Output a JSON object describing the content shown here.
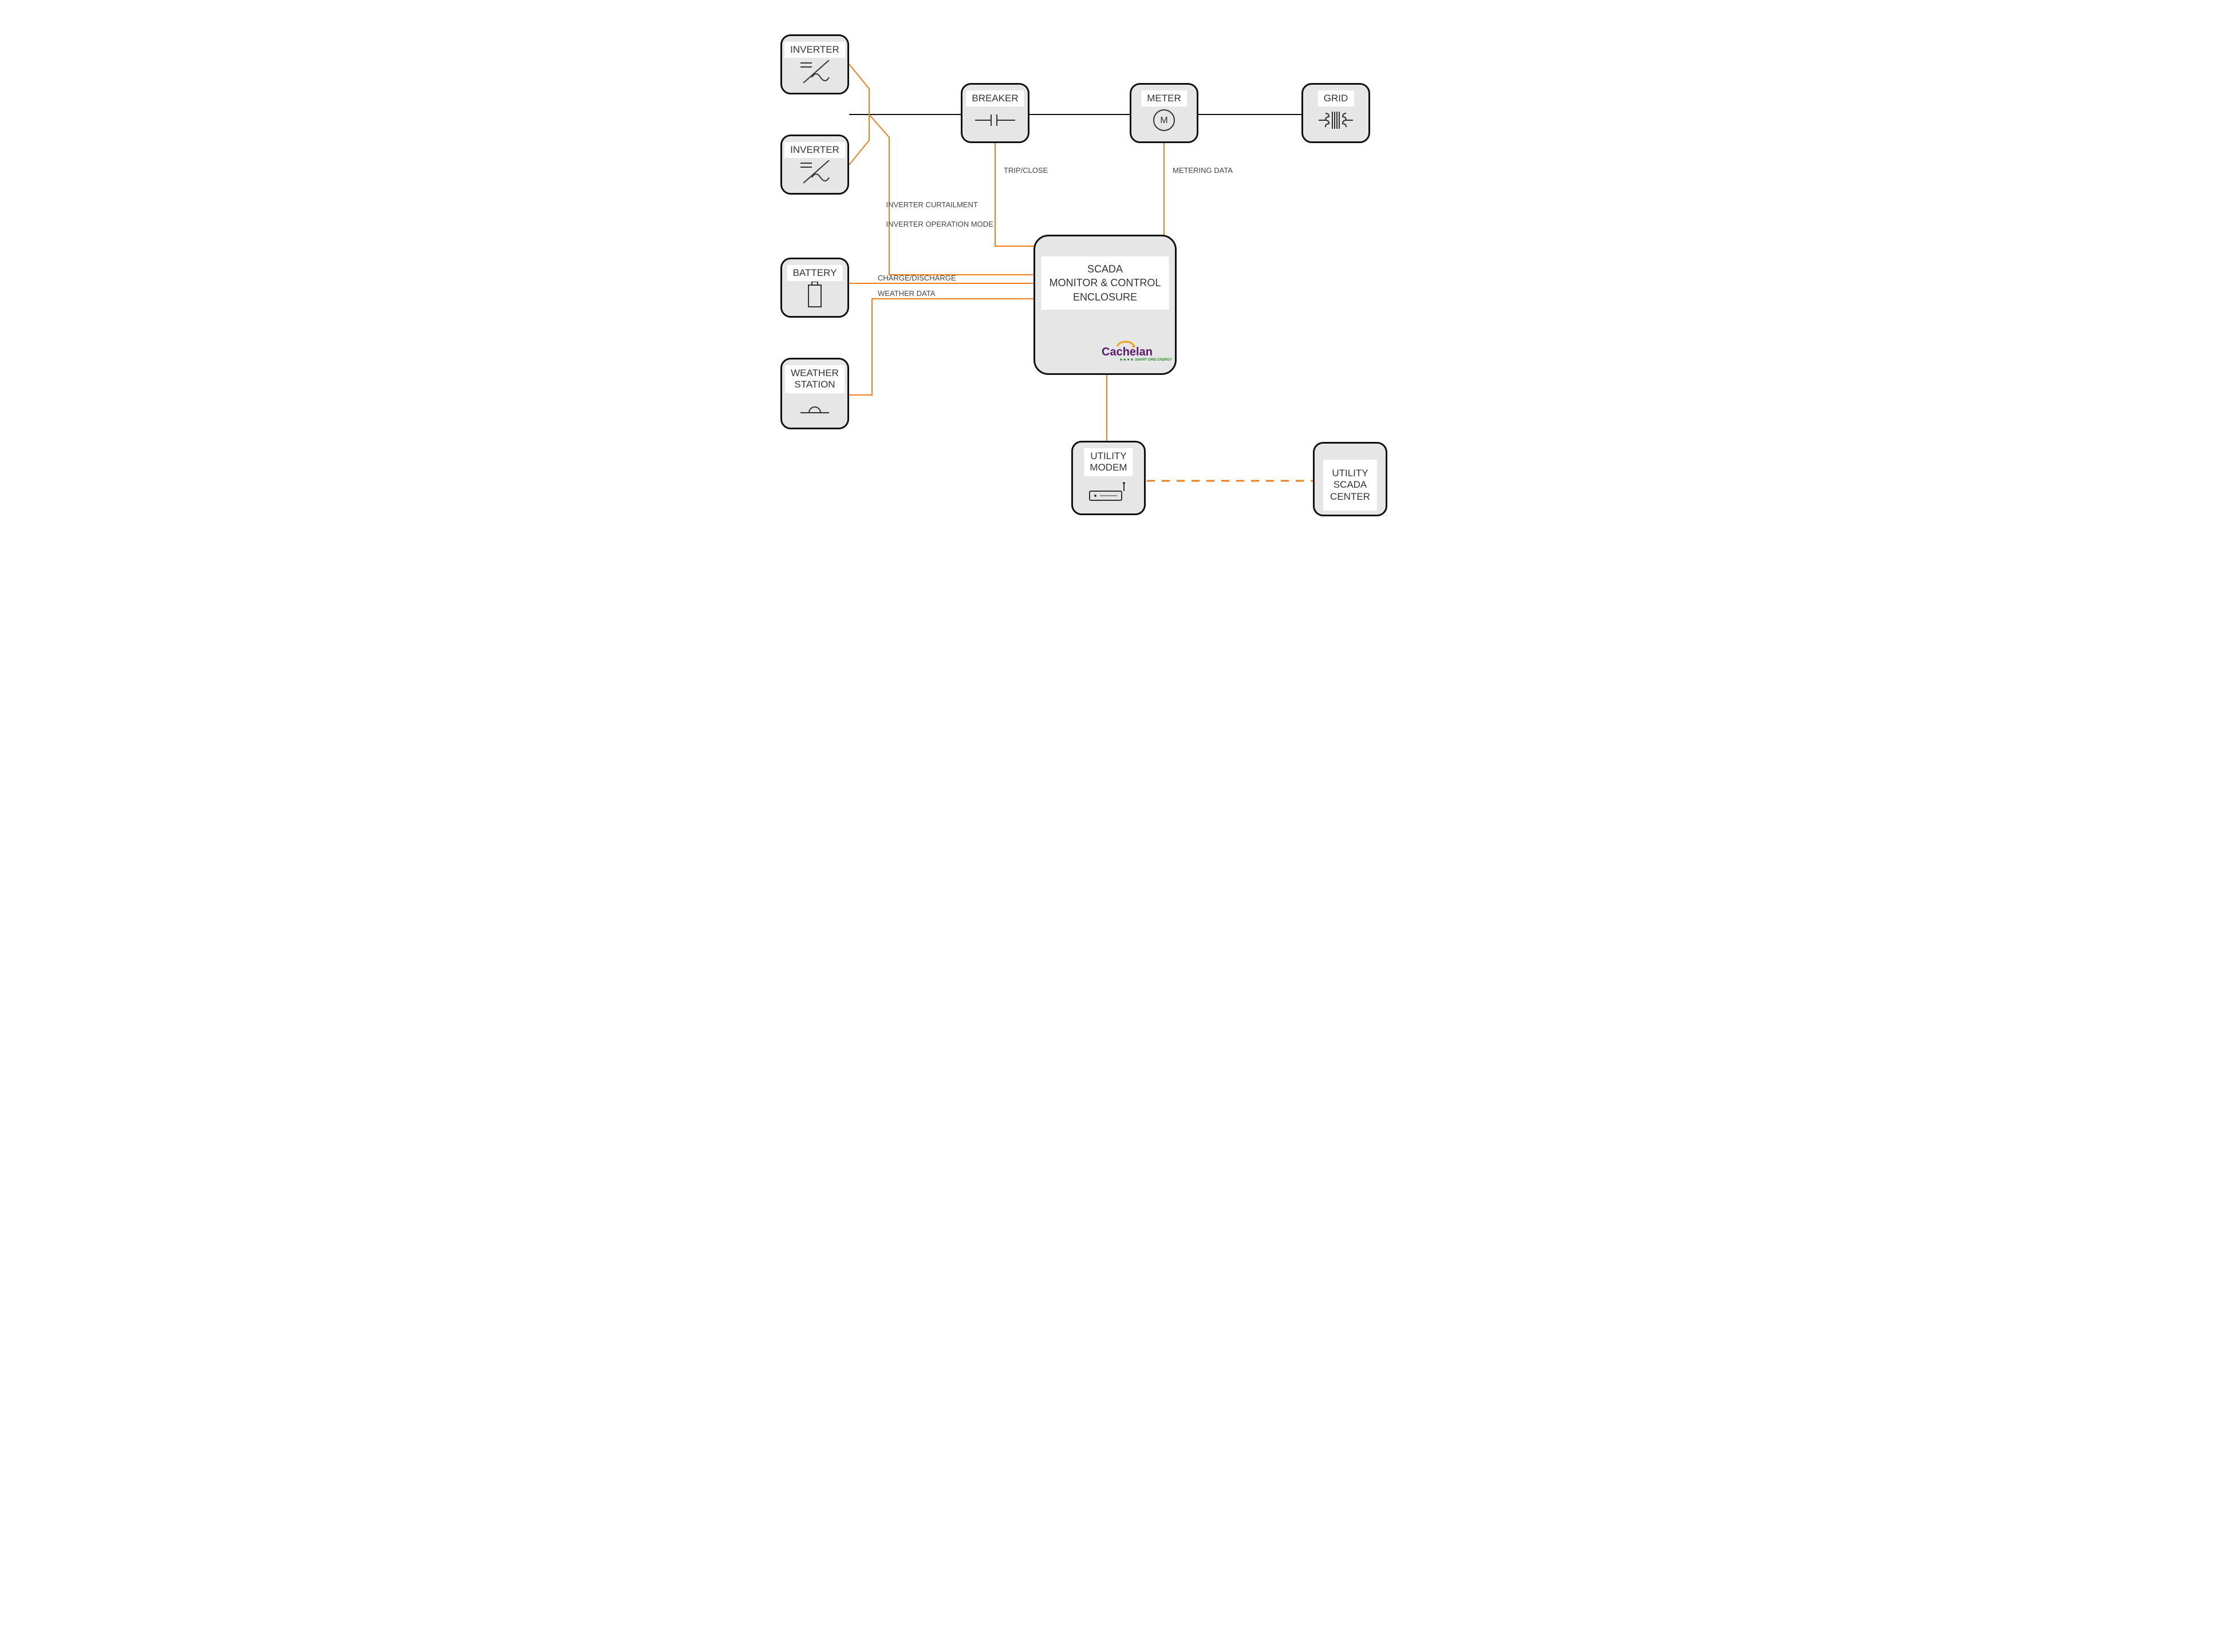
{
  "colors": {
    "power": "#111111",
    "data": "#f07e1a",
    "fill": "#e6e6e6"
  },
  "nodes": {
    "inverter1": {
      "label": "INVERTER"
    },
    "inverter2": {
      "label": "INVERTER"
    },
    "breaker": {
      "label": "BREAKER"
    },
    "meter": {
      "label": "METER",
      "badge": "M"
    },
    "grid": {
      "label": "GRID"
    },
    "battery": {
      "label": "BATTERY"
    },
    "weather": {
      "label_line1": "WEATHER",
      "label_line2": "STATION"
    },
    "scada": {
      "title_line1": "SCADA",
      "title_line2": "MONITOR & CONTROL",
      "title_line3": "ENCLOSURE"
    },
    "modem": {
      "label_line1": "UTILITY",
      "label_line2": "MODEM"
    },
    "center": {
      "label_line1": "UTILITY",
      "label_line2": "SCADA",
      "label_line3": "CENTER"
    }
  },
  "edge_labels": {
    "inverter_ops_line1": "INVERTER CURTAILMENT",
    "inverter_ops_line2": "INVERTER OPERATION MODE",
    "breaker": "TRIP/CLOSE",
    "meter": "METERING DATA",
    "battery": "CHARGE/DISCHARGE",
    "weather": "WEATHER DATA"
  },
  "brand": {
    "name": "Cachelan",
    "tagline": "SMART GRID ENERGY"
  }
}
